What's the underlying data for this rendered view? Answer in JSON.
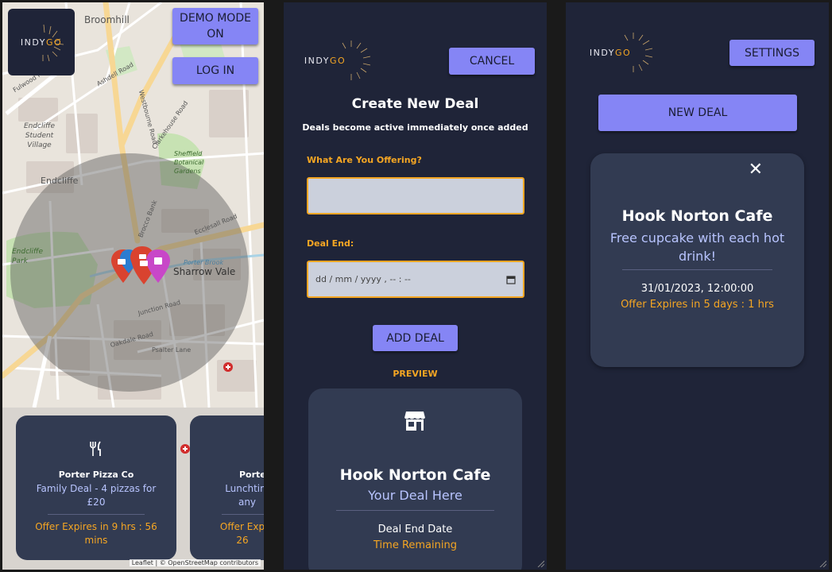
{
  "map_panel": {
    "demo_mode_label": "DEMO MODE ON",
    "login_label": "LOG IN",
    "logo": {
      "indy": "INDY",
      "go": "GO"
    },
    "place_labels": [
      "Broomhill",
      "Endcliffe Student Village",
      "Endcliffe",
      "Endcliffe Park",
      "Sharrow Vale",
      "Sheffield Botanical Gardens"
    ],
    "road_labels": [
      "Ecclesall Road",
      "Clarkehouse Road",
      "Westbourne Road",
      "Brocco Bank",
      "Junction Road",
      "Psalter Lane",
      "Fulwood Road",
      "Porter Brook",
      "Oakdale Road",
      "Ashdell Road"
    ],
    "deals": [
      {
        "name": "Porter Pizza Co",
        "description": "Family Deal - 4 pizzas for £20",
        "expiry": "Offer Expires in 9 hrs : 56 mins"
      },
      {
        "name": "Porter",
        "description": "Lunchtim any",
        "expiry": "Offer Exp 26"
      }
    ],
    "attribution": "Leaflet | © OpenStreetMap contributors"
  },
  "form_panel": {
    "logo": {
      "indy": "INDY",
      "go": "GO"
    },
    "cancel_label": "CANCEL",
    "title": "Create New Deal",
    "subtitle": "Deals become active immediately once added",
    "offer_label": "What Are You Offering?",
    "offer_value": "",
    "deal_end_label": "Deal End:",
    "deal_end_placeholder": "dd / mm / yyyy ,  -- : --",
    "add_deal_label": "ADD DEAL",
    "preview_label": "PREVIEW",
    "preview": {
      "name": "Hook Norton Cafe",
      "description": "Your Deal Here",
      "end_date": "Deal End Date",
      "remaining": "Time Remaining"
    }
  },
  "settings_panel": {
    "logo": {
      "indy": "INDY",
      "go": "GO"
    },
    "settings_label": "SETTINGS",
    "new_deal_label": "NEW DEAL",
    "deal": {
      "name": "Hook Norton Cafe",
      "description": "Free cupcake with each hot drink!",
      "date": "31/01/2023, 12:00:00",
      "expiry": "Offer Expires in 5 days : 1 hrs"
    },
    "close_glyph": "✕"
  },
  "colors": {
    "accent": "#8585f5",
    "orange": "#f5a623",
    "panel_bg": "#1f2438",
    "card_bg": "#323b52",
    "pin_red": "#d9432f",
    "pin_purple": "#c847c8"
  }
}
